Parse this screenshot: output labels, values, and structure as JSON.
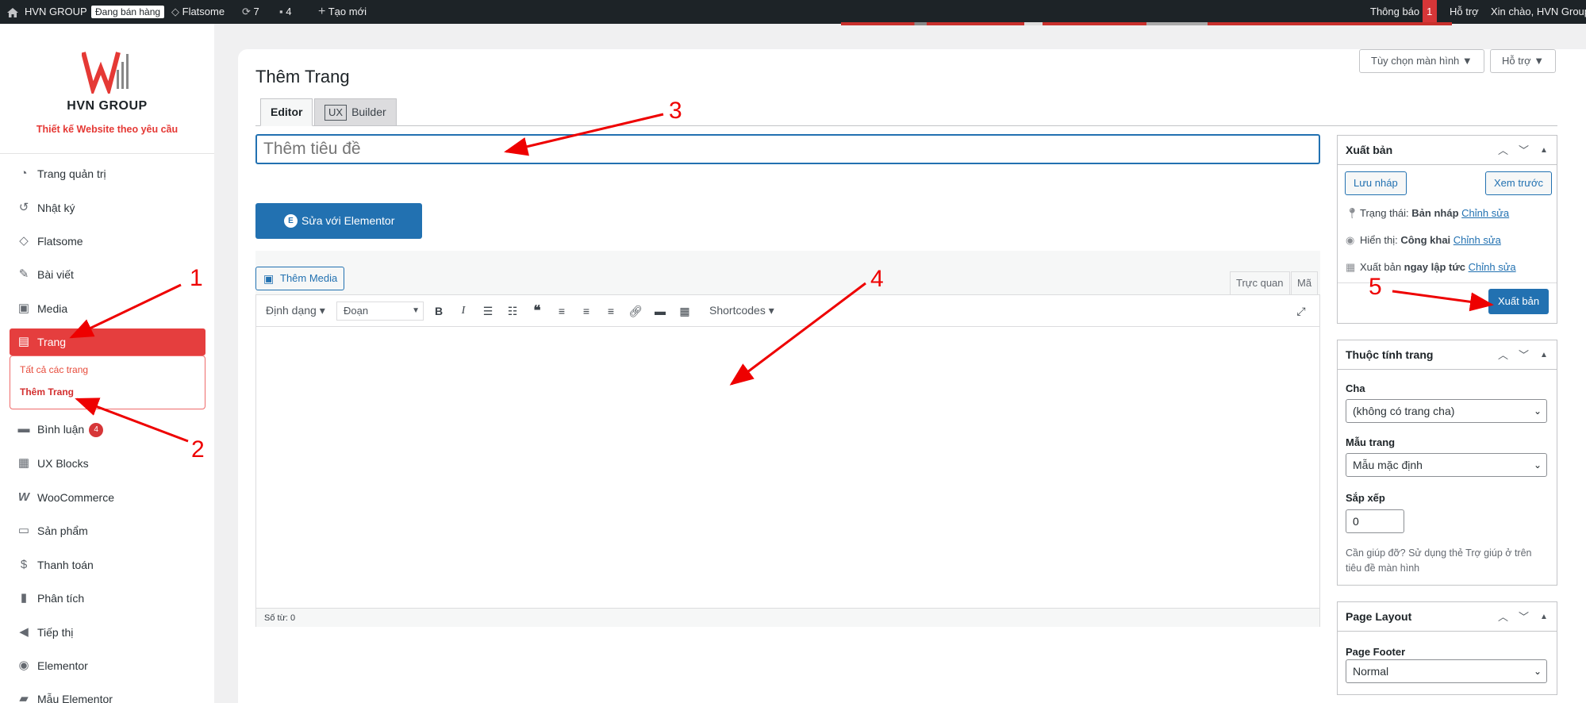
{
  "adminbar": {
    "site_name": "HVN GROUP",
    "store_status": "Đang bán hàng",
    "theme": "Flatsome",
    "updates_count": "7",
    "comments_count": "4",
    "new_label": "Tạo mới",
    "notifications_label": "Thông báo",
    "notifications_count": "1",
    "help_label": "Hỗ trợ",
    "greeting": "Xin chào, HVN Group"
  },
  "logo": {
    "name": "HVN GROUP",
    "tagline": "Thiết kế Website theo yêu cầu"
  },
  "sidebar": {
    "items": [
      {
        "label": "Trang quản trị",
        "icon": "dashboard-icon"
      },
      {
        "label": "Nhật ký",
        "icon": "history-icon"
      },
      {
        "label": "Flatsome",
        "icon": "flatsome-icon"
      },
      {
        "label": "Bài viết",
        "icon": "pin-icon"
      },
      {
        "label": "Media",
        "icon": "media-icon"
      },
      {
        "label": "Trang",
        "icon": "pages-icon"
      },
      {
        "label": "Bình luận",
        "icon": "comments-icon",
        "badge": "4"
      },
      {
        "label": "UX Blocks",
        "icon": "blocks-icon"
      },
      {
        "label": "WooCommerce",
        "icon": "woocommerce-icon"
      },
      {
        "label": "Sản phẩm",
        "icon": "products-icon"
      },
      {
        "label": "Thanh toán",
        "icon": "payments-icon"
      },
      {
        "label": "Phân tích",
        "icon": "analytics-icon"
      },
      {
        "label": "Tiếp thị",
        "icon": "marketing-icon"
      },
      {
        "label": "Elementor",
        "icon": "elementor-icon"
      },
      {
        "label": "Mẫu Elementor",
        "icon": "folder-icon"
      }
    ],
    "submenu": {
      "all_pages": "Tất cả các trang",
      "add_page": "Thêm Trang"
    }
  },
  "screen_options": {
    "screen_label": "Tùy chọn màn hình ▼",
    "help_label": "Hỗ trợ ▼"
  },
  "page": {
    "title": "Thêm Trang",
    "tab_editor": "Editor",
    "tab_ux": "UX",
    "tab_builder": "Builder",
    "title_placeholder": "Thêm tiêu đề",
    "elementor_button": "Sửa với Elementor"
  },
  "editor": {
    "add_media": "Thêm Media",
    "tab_visual": "Trực quan",
    "tab_code": "Mã",
    "format_select": "Định dạng ▾",
    "paragraph_select": "Đoạn",
    "shortcodes": "Shortcodes ▾",
    "word_count": "Số từ: 0"
  },
  "publish_box": {
    "title": "Xuất bản",
    "save_draft": "Lưu nháp",
    "preview": "Xem trước",
    "status_label": "Trạng thái:",
    "status_value": "Bản nháp",
    "visibility_label": "Hiển thị:",
    "visibility_value": "Công khai",
    "publish_time_label": "Xuất bản",
    "publish_time_value": "ngay lập tức",
    "edit_link": "Chỉnh sửa",
    "publish_button": "Xuất bản"
  },
  "attributes_box": {
    "title": "Thuộc tính trang",
    "parent_label": "Cha",
    "parent_value": "(không có trang cha)",
    "template_label": "Mẫu trang",
    "template_value": "Mẫu mặc định",
    "order_label": "Sắp xếp",
    "order_value": "0",
    "help_text": "Cần giúp đỡ? Sử dụng thẻ Trợ giúp ở trên tiêu đề màn hình"
  },
  "layout_box": {
    "title": "Page Layout",
    "footer_label": "Page Footer",
    "footer_value": "Normal"
  },
  "annotations": {
    "n1": "1",
    "n2": "2",
    "n3": "3",
    "n4": "4",
    "n5": "5"
  },
  "colors": {
    "admin_bar": "#1d2327",
    "accent_blue": "#2271b1",
    "active_menu": "#e53e3e",
    "annotation": "#ee0000"
  }
}
